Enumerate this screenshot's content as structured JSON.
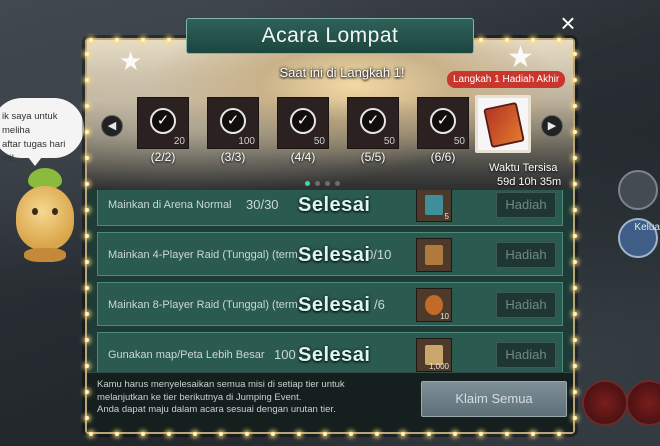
{
  "event": {
    "title": "Acara Lompat",
    "current_step_text": "Saat ini di Langkah 1!",
    "final_reward_tag": "Langkah 1 Hadiah Akhir",
    "remaining_label": "Waktu Tersisa",
    "remaining_value": "59d 10h 35m",
    "close_icon": "×",
    "tiers": [
      {
        "label": "(2/2)",
        "count": "20"
      },
      {
        "label": "(3/3)",
        "count": "100"
      },
      {
        "label": "(4/4)",
        "count": "50"
      },
      {
        "label": "(5/5)",
        "count": "50"
      },
      {
        "label": "(6/6)",
        "count": "50"
      }
    ],
    "arrows": {
      "left": "◀",
      "right": "▶"
    }
  },
  "missions": [
    {
      "text": "Mainkan di Arena Normal",
      "progress": "30/30",
      "status": "Selesai",
      "qty": "5",
      "reward": "Hadiah"
    },
    {
      "text": "Mainkan 4-Player Raid (Tunggal) (term",
      "progress": "0/10",
      "status": "Selesai",
      "qty": "",
      "reward": "Hadiah"
    },
    {
      "text": "Mainkan 8-Player Raid (Tunggal) (term",
      "progress": "/6",
      "status": "Selesai",
      "qty": "10",
      "reward": "Hadiah"
    },
    {
      "text": "Gunakan map/Peta Lebih Besar",
      "progress": "100",
      "status": "Selesai",
      "qty": "1,000",
      "reward": "Hadiah"
    }
  ],
  "footer": {
    "note_lines": [
      "Kamu harus menyelesaikan semua misi di setiap tier untuk",
      "melanjutkan ke tier berikutnya di Jumping Event.",
      "Anda dapat maju dalam acara sesuai dengan urutan tier."
    ],
    "claim_all": "Klaim Semua"
  },
  "npc": {
    "speech_lines": [
      "ik saya untuk meliha",
      "aftar tugas hari ini!"
    ]
  },
  "hud": {
    "right_label": "Kelua"
  },
  "colors": {
    "modal_bg": "#1f3b36",
    "row_bg": "#2b5a50",
    "done_text": "#dff5ef",
    "final_tag": "#c9362e",
    "active_dot": "#38d7b6"
  }
}
